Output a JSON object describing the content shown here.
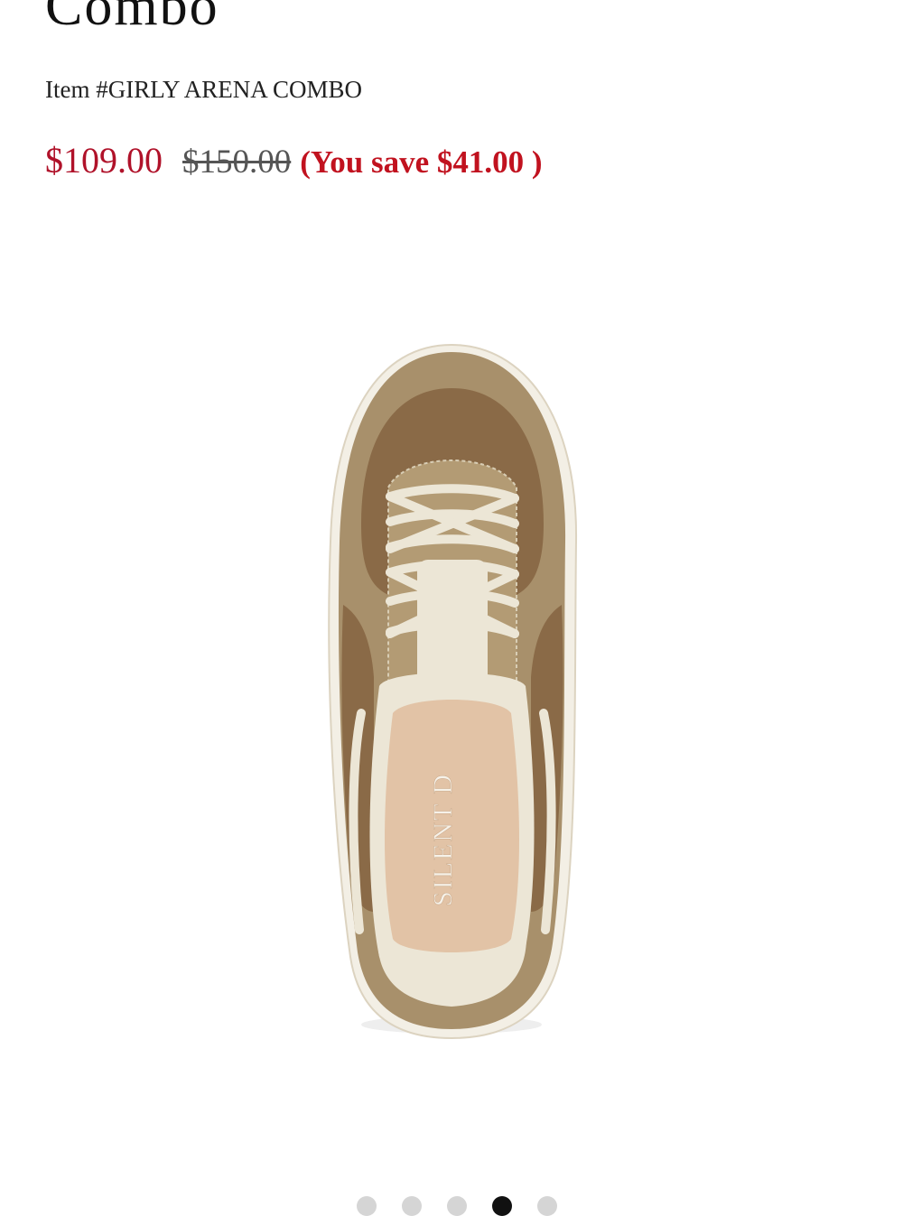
{
  "product": {
    "title": "Combo",
    "item_number": "Item #GIRLY ARENA COMBO",
    "price": {
      "sale": "$109.00",
      "original": "$150.00",
      "savings": "(You save $41.00 )"
    },
    "image": {
      "insole_brand": "SILENT D"
    }
  },
  "carousel": {
    "total_dots": 5,
    "active_index": 3
  },
  "colors": {
    "sale_price": "#b0122a",
    "savings_text": "#c1121f",
    "suede": "#a8906b",
    "mesh": "#8a6a47",
    "cream": "#ece6d6",
    "insole": "#e2c3a6"
  }
}
